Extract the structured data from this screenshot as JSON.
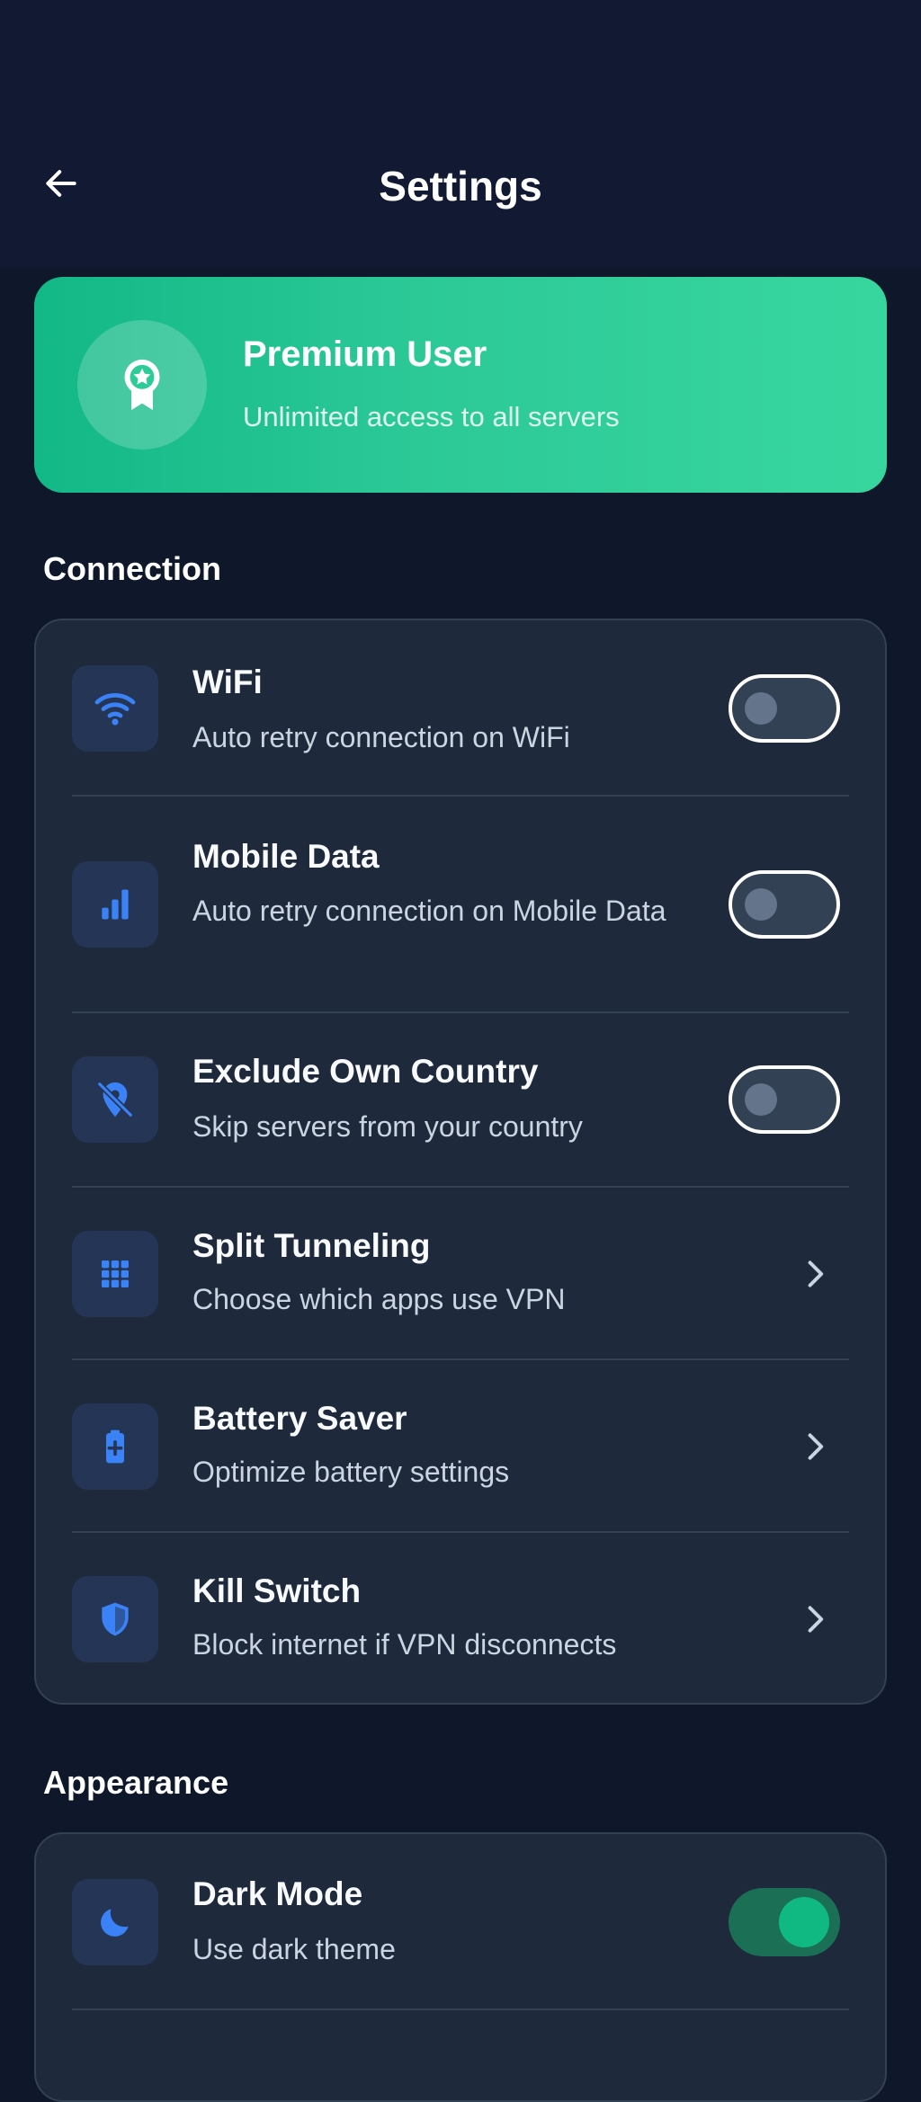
{
  "app_bar": {
    "title": "Settings"
  },
  "premium": {
    "title": "Premium User",
    "subtitle": "Unlimited access to all servers"
  },
  "sections": {
    "connection": {
      "title": "Connection",
      "items": [
        {
          "title": "WiFi",
          "subtitle": "Auto retry connection on WiFi",
          "icon": "wifi-icon",
          "control": "toggle",
          "on": false
        },
        {
          "title": "Mobile Data",
          "subtitle": "Auto retry connection on Mobile Data",
          "icon": "signal-bars-icon",
          "control": "toggle",
          "on": false
        },
        {
          "title": "Exclude Own Country",
          "subtitle": "Skip servers from your country",
          "icon": "location-off-icon",
          "control": "toggle",
          "on": false
        },
        {
          "title": "Split Tunneling",
          "subtitle": "Choose which apps use VPN",
          "icon": "apps-grid-icon",
          "control": "chevron"
        },
        {
          "title": "Battery Saver",
          "subtitle": "Optimize battery settings",
          "icon": "battery-plus-icon",
          "control": "chevron"
        },
        {
          "title": "Kill Switch",
          "subtitle": "Block internet if VPN disconnects",
          "icon": "shield-icon",
          "control": "chevron"
        }
      ]
    },
    "appearance": {
      "title": "Appearance",
      "items": [
        {
          "title": "Dark Mode",
          "subtitle": "Use dark theme",
          "icon": "moon-icon",
          "control": "toggle",
          "on": true
        }
      ]
    }
  },
  "colors": {
    "background": "#0f172a",
    "card": "#1e293b",
    "accent_icon": "#3b82f6",
    "premium_gradient_start": "#12b886",
    "premium_gradient_end": "#38d69f",
    "toggle_on": "#10b981"
  }
}
